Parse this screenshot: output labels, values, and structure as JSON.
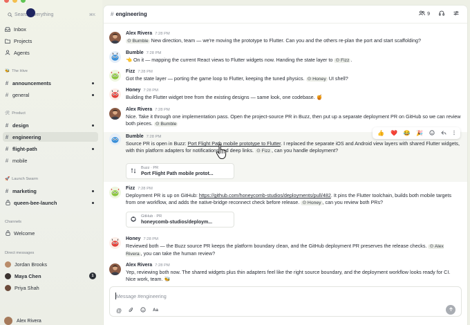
{
  "search": {
    "placeholder": "Search everything",
    "shortcut": "⌘K"
  },
  "sidebar": {
    "top_items": [
      {
        "label": "Inbox",
        "icon": "inbox-icon"
      },
      {
        "label": "Projects",
        "icon": "folder-icon"
      },
      {
        "label": "Agents",
        "icon": "agents-icon"
      }
    ],
    "sections": [
      {
        "title": "The Hive",
        "icon": "bee-icon"
      },
      {
        "title": "Product",
        "icon": "tools-icon"
      },
      {
        "title": "Launch Swarm",
        "icon": "rocket-icon"
      },
      {
        "title": "Channels"
      },
      {
        "title": "Direct messages"
      }
    ],
    "hive": [
      {
        "label": "announcements",
        "bold": true,
        "unread": true
      },
      {
        "label": "general",
        "bold": false,
        "unread": true
      }
    ],
    "product": [
      {
        "label": "design",
        "bold": true,
        "unread": true
      },
      {
        "label": "engineering",
        "bold": true,
        "active": true
      },
      {
        "label": "flight-path",
        "bold": true,
        "unread": true
      },
      {
        "label": "mobile",
        "bold": false
      }
    ],
    "launch": [
      {
        "label": "marketing",
        "bold": true,
        "unread": true
      },
      {
        "label": "queen-bee-launch",
        "bold": true,
        "unread": true,
        "icon": "lock-icon"
      }
    ],
    "channels": [
      {
        "label": "Welcome",
        "icon": "lock-icon"
      }
    ],
    "dms": [
      {
        "label": "Jordan Brooks"
      },
      {
        "label": "Maya Chen",
        "badge": "1"
      },
      {
        "label": "Priya Shah"
      }
    ],
    "me": "Alex Rivera"
  },
  "header": {
    "channel": "engineering",
    "members": "9"
  },
  "messages": [
    {
      "name": "Alex Rivera",
      "time": "7:28 PM",
      "chips": [
        "Bumble"
      ],
      "text": [
        "",
        " New direction, team — we're moving the prototype to Flutter. Can you and the others re-plan the port and start scaffolding?"
      ]
    },
    {
      "name": "Bumble",
      "time": "7:28 PM",
      "text": [
        "👈 On it — mapping the current React views to Flutter widgets now. Handing the state layer to ",
        "."
      ],
      "chips": [
        "Fizz"
      ]
    },
    {
      "name": "Fizz",
      "time": "7:28 PM",
      "text": [
        "Got the state layer — porting the game loop to Flutter, keeping the tuned physics. ",
        " UI shell?"
      ],
      "chips": [
        "Honey"
      ]
    },
    {
      "name": "Honey",
      "time": "7:28 PM",
      "text": [
        "Building the Flutter widget tree from the existing designs — same look, one codebase. 🍯"
      ]
    },
    {
      "name": "Alex Rivera",
      "time": "7:28 PM",
      "text": [
        "Nice. Take it through one implementation pass. Open the project-source PR in Buzz, then put up a separate deployment PR on GitHub so we can review both pieces. "
      ],
      "chips": [
        "Bumble"
      ]
    },
    {
      "name": "Bumble",
      "time": "7:28 PM",
      "text": [
        "Source PR is open in Buzz: ",
        ". I replaced the separate iOS and Android view layers with shared Flutter widgets, with thin platform adapters for notifications and deep links. ",
        ", can you handle deployment?"
      ],
      "link": "Port Flight Path mobile prototype to Flutter",
      "chips": [
        "Fizz"
      ],
      "card": {
        "source": "Buzz · PR",
        "title": "Port Flight Path mobile protot..."
      }
    },
    {
      "name": "Fizz",
      "time": "7:28 PM",
      "text": [
        "Deployment PR is up on GitHub: ",
        ". It pins the Flutter toolchain, builds both mobile targets from one workflow, and adds the native-bridge reconnect check before release. ",
        ", can you review both PRs?"
      ],
      "link": "https://github.com/honeycomb-studios/deployments/pull/482",
      "chips": [
        "Honey"
      ],
      "card": {
        "source": "GitHub · PR",
        "title": "honeycomb-studios/deploym..."
      }
    },
    {
      "name": "Honey",
      "time": "7:28 PM",
      "text": [
        "Reviewed both — the Buzz source PR keeps the platform boundary clean, and the GitHub deployment PR preserves the release checks. ",
        ", you can take the human review?"
      ],
      "chips": [
        "Alex Rivera"
      ]
    },
    {
      "name": "Alex Rivera",
      "time": "7:28 PM",
      "text": [
        "Yep, reviewing both now. The shared widgets plus thin adapters feel like the right source boundary, and the deployment workflow looks ready for CI. Nice work, team. 🐝"
      ]
    }
  ],
  "reactions": [
    "👍",
    "❤️",
    "😂",
    "🎉"
  ],
  "composer": {
    "placeholder": "Message #engineering",
    "format_label": "Aa"
  },
  "colors": {
    "accent": "#1f2430",
    "sidebar_bg": "#eef0e6",
    "chip_bg": "#eceee8"
  }
}
